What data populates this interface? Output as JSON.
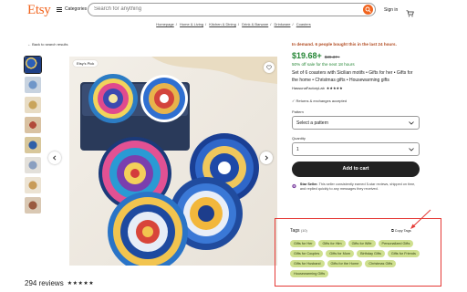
{
  "header": {
    "logo": "Etsy",
    "categories_label": "Categories",
    "search_placeholder": "Search for anything",
    "signin_label": "Sign in"
  },
  "breadcrumb": [
    "Homepage",
    "Home & Living",
    "Kitchen & Dining",
    "Drink & Barware",
    "Drinkware",
    "Coasters"
  ],
  "back_label": "Back to search results",
  "gallery": {
    "etsy_pick_label": "Etsy's Pick",
    "thumb_count": 8
  },
  "reviews": {
    "count_label": "294 reviews",
    "stars": "★★★★★"
  },
  "product": {
    "demand": "In demand. 6 people bought this in the last 24 hours.",
    "price": "$19.68+",
    "old_price": "$39.37+",
    "sale": "50% off sale for the next 18 hours",
    "title": "Set of 6 coasters with Sicilian motifs • Gifts for her • Gifts for the home • Christmas gifts • Housewarming gifts",
    "shop": "HassunaFactoryLab",
    "shop_stars": "★★★★★",
    "returns": "Returns & exchanges accepted",
    "pattern_label": "Pattern",
    "pattern_value": "Select a pattern",
    "quantity_label": "Quantity",
    "quantity_value": "1",
    "add_to_cart": "Add to cart",
    "seller_title": "Star Seller.",
    "seller_text": "This seller consistently earned 5-star reviews, shipped on time, and replied quickly to any messages they received."
  },
  "tags": {
    "heading": "Tags",
    "count": "(10)",
    "copy_label": "Copy Tags",
    "items": [
      "Gifts for Her",
      "Gifts for Him",
      "Gifts for Wife",
      "Personalized Gifts",
      "Gifts for Couples",
      "Gifts for Mom",
      "Birthday Gifts",
      "Gifts for Friends",
      "Gifts for Husband",
      "Gifts for the Home",
      "Christmas Gifts",
      "Housewarming Gifts"
    ]
  },
  "colors": {
    "brand": "#f1641e",
    "price_green": "#258635",
    "tag_bg": "#cfe08f",
    "highlight_red": "#e53935"
  }
}
